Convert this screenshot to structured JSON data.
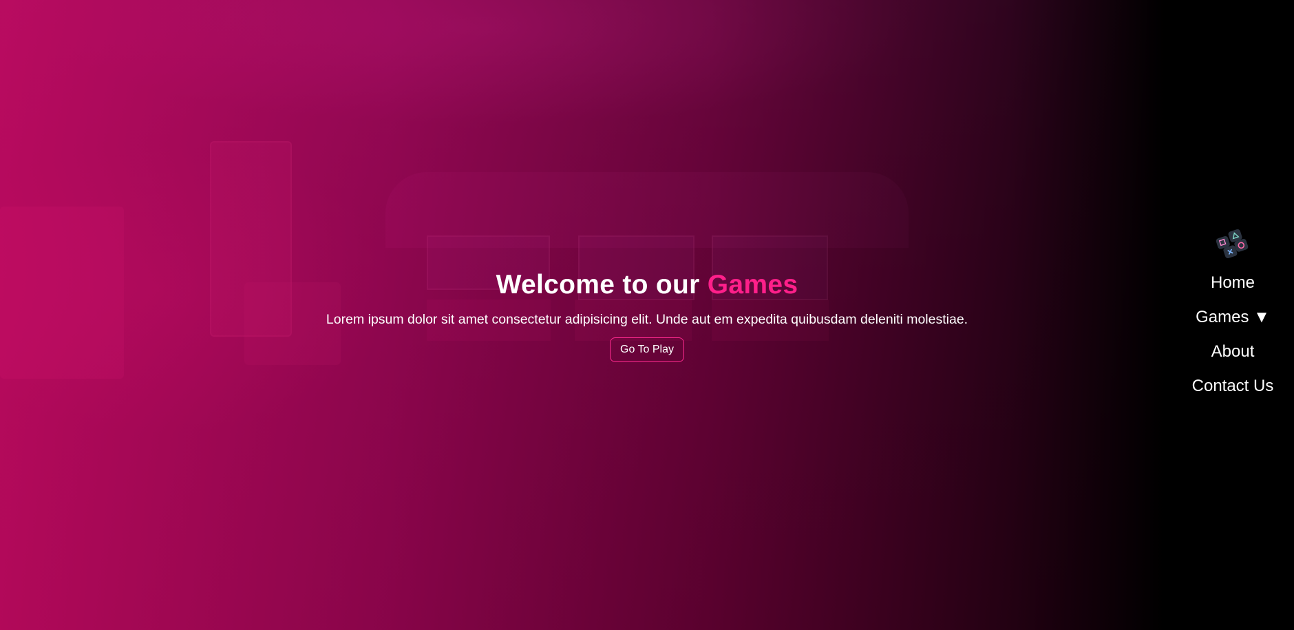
{
  "hero": {
    "title_prefix": "Welcome to our ",
    "title_accent": "Games",
    "subtitle": "Lorem ipsum dolor sit amet consectetur adipisicing elit. Unde aut em expedita quibusdam deleniti molestiae.",
    "cta_label": "Go To Play"
  },
  "nav": {
    "logo_icon": "gamepad-buttons-icon",
    "items": [
      {
        "label": "Home"
      },
      {
        "label": "Games ▼"
      },
      {
        "label": "About"
      },
      {
        "label": "Contact Us"
      }
    ]
  },
  "colors": {
    "accent": "#ff1f8a",
    "overlay_left": "#c80a64",
    "overlay_right": "#000000"
  }
}
